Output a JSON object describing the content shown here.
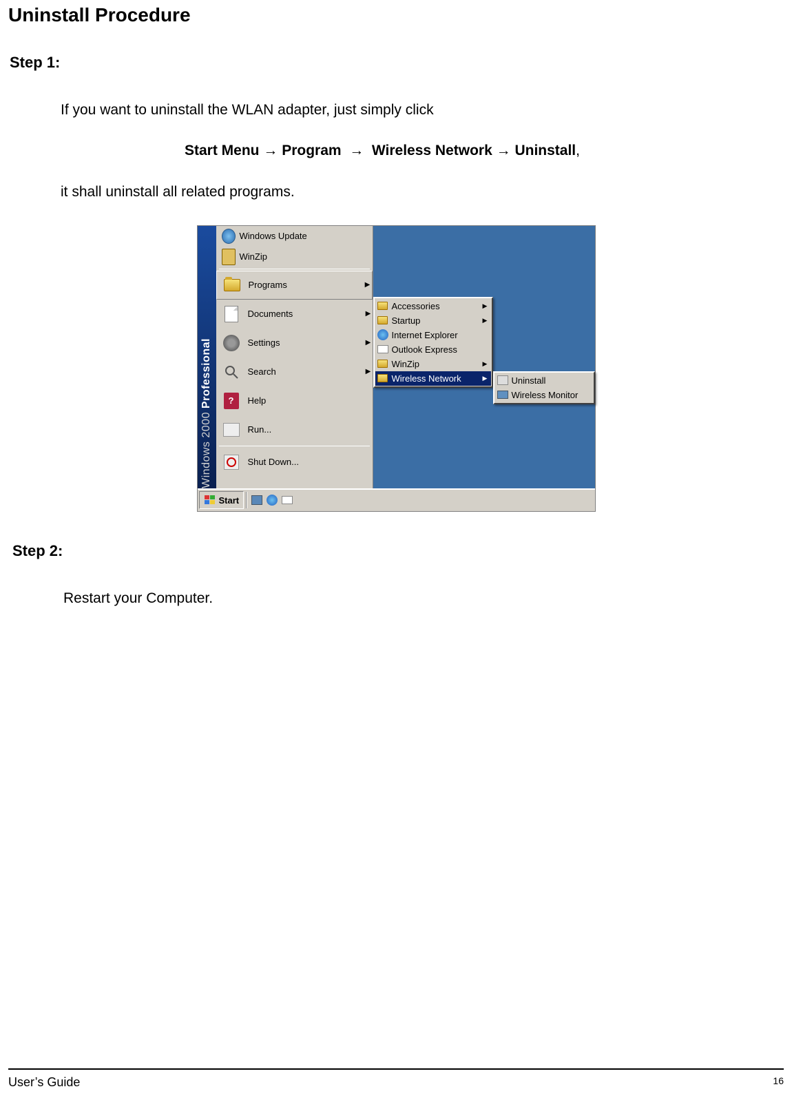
{
  "title": "Uninstall Procedure",
  "step1": {
    "heading": "Step 1:",
    "line1": "If you want to uninstall the WLAN adapter, just simply click",
    "nav_parts": {
      "p1": "Start Menu",
      "p2": "Program",
      "p3": "Wireless Network",
      "p4": "Uninstall"
    },
    "arrow": "→",
    "line3": "it shall uninstall all related programs."
  },
  "step2": {
    "heading": "Step 2:",
    "line1": "Restart your Computer."
  },
  "footer": {
    "left": "User’s Guide",
    "pagenum": "16"
  },
  "screenshot": {
    "banner_light": "Windows 2000",
    "banner_bold": "Professional",
    "top_items": [
      {
        "label": "Windows Update",
        "icon": "globe"
      },
      {
        "label": "WinZip",
        "icon": "winzip"
      }
    ],
    "col1_items": [
      {
        "label": "Programs",
        "icon": "folder",
        "arrow": true,
        "raised": true
      },
      {
        "label": "Documents",
        "icon": "doc",
        "arrow": true
      },
      {
        "label": "Settings",
        "icon": "gear",
        "arrow": true
      },
      {
        "label": "Search",
        "icon": "search",
        "arrow": true
      },
      {
        "label": "Help",
        "icon": "help"
      },
      {
        "label": "Run...",
        "icon": "run"
      }
    ],
    "shutdown": {
      "label": "Shut Down...",
      "icon": "shut"
    },
    "col2_items": [
      {
        "label": "Accessories",
        "icon": "folder-sm",
        "arrow": true
      },
      {
        "label": "Startup",
        "icon": "folder-sm",
        "arrow": true
      },
      {
        "label": "Internet Explorer",
        "icon": "ie"
      },
      {
        "label": "Outlook Express",
        "icon": "outlook"
      },
      {
        "label": "WinZip",
        "icon": "folder-sm",
        "arrow": true
      },
      {
        "label": "Wireless Network",
        "icon": "folder-sm",
        "arrow": true,
        "sel": true
      }
    ],
    "col3_items": [
      {
        "label": "Uninstall",
        "icon": "uninst"
      },
      {
        "label": "Wireless Monitor",
        "icon": "mon"
      }
    ],
    "taskbar": {
      "start": "Start"
    }
  }
}
